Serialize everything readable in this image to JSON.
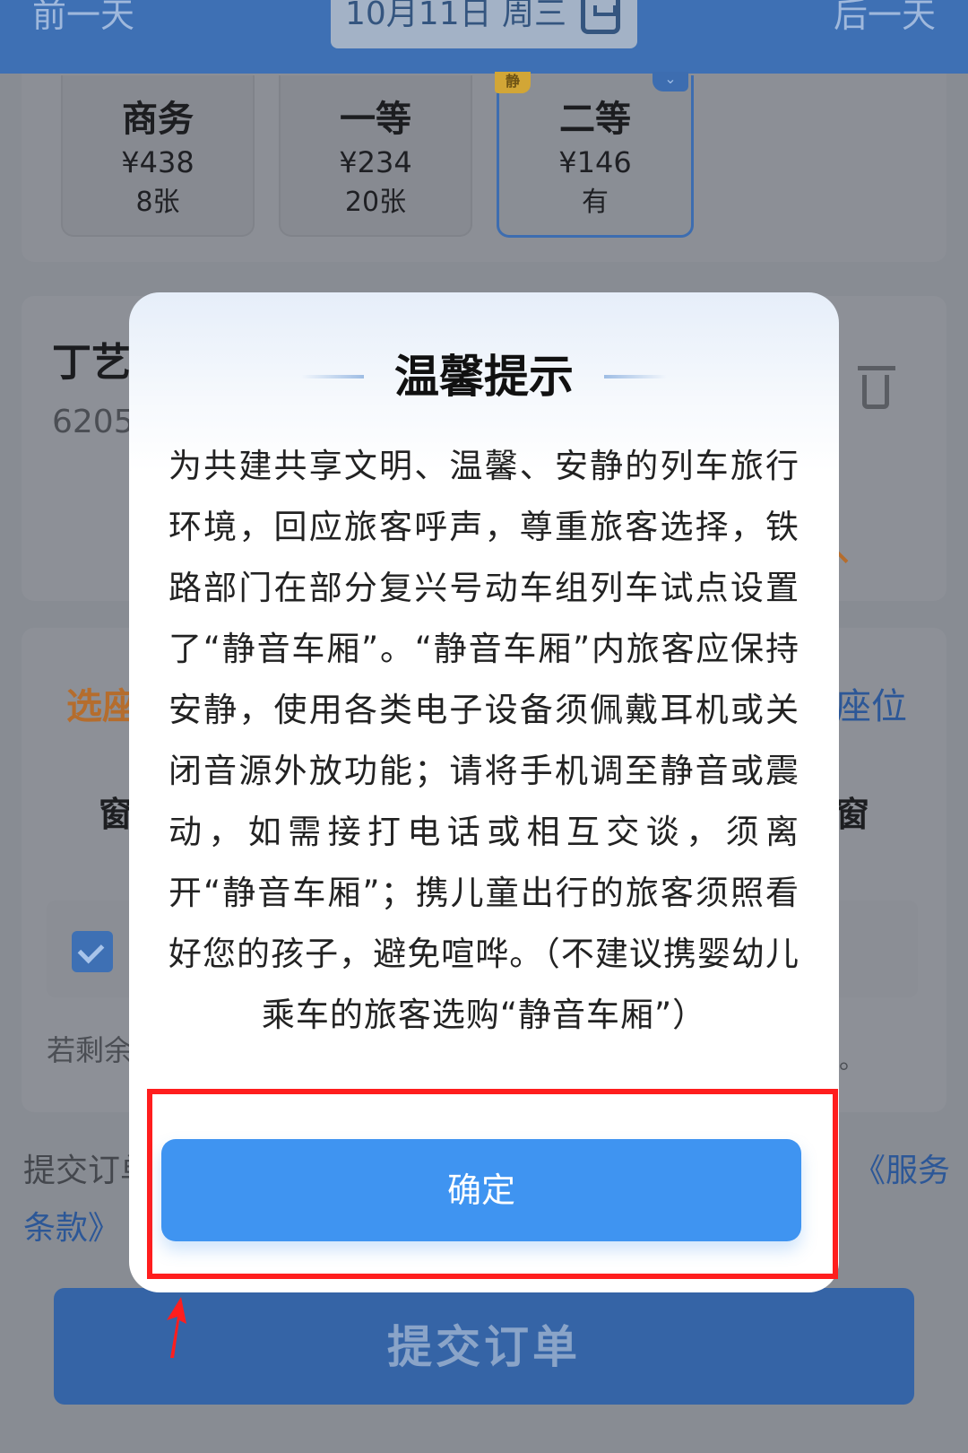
{
  "header": {
    "prev_day": "前一天",
    "date": "10月11日 周三",
    "next_day": "后一天"
  },
  "seats": [
    {
      "name": "商务",
      "price": "¥438",
      "count": "8张"
    },
    {
      "name": "一等",
      "price": "¥234",
      "count": "20张"
    },
    {
      "name": "二等",
      "price": "¥146",
      "count": "有",
      "tag": "静"
    }
  ],
  "passenger": {
    "name": "丁艺",
    "id": "6205"
  },
  "seat_selection": {
    "label": "选座",
    "choose_link": "座位",
    "window_left": "窗",
    "window_right": "窗",
    "remaining": "若剩余",
    "period": "。"
  },
  "terms": {
    "prefix": "提交订单",
    "link_part1": "《服务",
    "link_part2": "条款》"
  },
  "submit": {
    "label": "提交订单"
  },
  "modal": {
    "title": "温馨提示",
    "body": "为共建共享文明、温馨、安静的列车旅行环境，回应旅客呼声，尊重旅客选择，铁路部门在部分复兴号动车组列车试点设置了“静音车厢”。“静音车厢”内旅客应保持安静，使用各类电子设备须佩戴耳机或关闭音源外放功能；请将手机调至静音或震动，如需接打电话或相互交谈，须离开“静音车厢”；携儿童出行的旅客须照看好您的孩子，避免喧哗。（不建议携婴幼儿乘车的旅客选购“静音车厢”）",
    "confirm": "确定"
  },
  "colors": {
    "primary": "#3f94f1",
    "highlight": "#ff1e1e",
    "header": "#3e70b4"
  }
}
